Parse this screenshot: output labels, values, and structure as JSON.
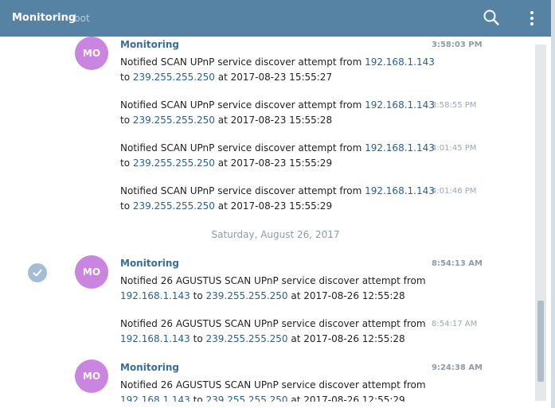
{
  "header": {
    "title": "Monitoring",
    "subtitle": "bot"
  },
  "date_separator": "Saturday, August 26, 2017",
  "groups": [
    {
      "avatar": "MO",
      "author": "Monitoring",
      "messages": [
        {
          "time": "3:58:03 PM",
          "line1": {
            "text": "Notified  SCAN UPnP service discover attempt from ",
            "link": "192.168.1.143"
          },
          "line2": {
            "pre": "to ",
            "link": "239.255.255.250",
            "post": " at 2017-08-23 15:55:27"
          }
        },
        {
          "time": "3:58:55 PM",
          "line1": {
            "text": "Notified  SCAN UPnP service discover attempt from ",
            "link": "192.168.1.143"
          },
          "line2": {
            "pre": "to ",
            "link": "239.255.255.250",
            "post": " at 2017-08-23 15:55:28"
          }
        },
        {
          "time": "4:01:45 PM",
          "line1": {
            "text": "Notified  SCAN UPnP service discover attempt from ",
            "link": "192.168.1.143"
          },
          "line2": {
            "pre": "to ",
            "link": "239.255.255.250",
            "post": " at 2017-08-23 15:55:29"
          }
        },
        {
          "time": "4:01:46 PM",
          "line1": {
            "text": "Notified  SCAN UPnP service discover attempt from ",
            "link": "192.168.1.143"
          },
          "line2": {
            "pre": "to ",
            "link": "239.255.255.250",
            "post": " at 2017-08-23 15:55:29"
          }
        }
      ]
    },
    {
      "avatar": "MO",
      "author": "Monitoring",
      "messages": [
        {
          "time": "8:54:13 AM",
          "line1": {
            "text": "Notified  26 AGUSTUS SCAN UPnP service discover attempt from"
          },
          "line2": {
            "link1": "192.168.1.143",
            "mid": " to ",
            "link2": "239.255.255.250",
            "post": " at 2017-08-26 12:55:28"
          }
        },
        {
          "time": "8:54:17 AM",
          "line1": {
            "text": "Notified  26 AGUSTUS SCAN UPnP service discover attempt from"
          },
          "line2": {
            "link1": "192.168.1.143",
            "mid": " to ",
            "link2": "239.255.255.250",
            "post": " at 2017-08-26 12:55:28"
          }
        }
      ]
    },
    {
      "avatar": "MO",
      "author": "Monitoring",
      "messages": [
        {
          "time": "9:24:38 AM",
          "line1": {
            "text": "Notified  26 AGUSTUS SCAN UPnP service discover attempt from"
          },
          "line2": {
            "link1": "192.168.1.143",
            "mid": " to ",
            "link2": "239.255.255.250",
            "post": " at 2017-08-26 12:55:29"
          }
        }
      ]
    }
  ]
}
